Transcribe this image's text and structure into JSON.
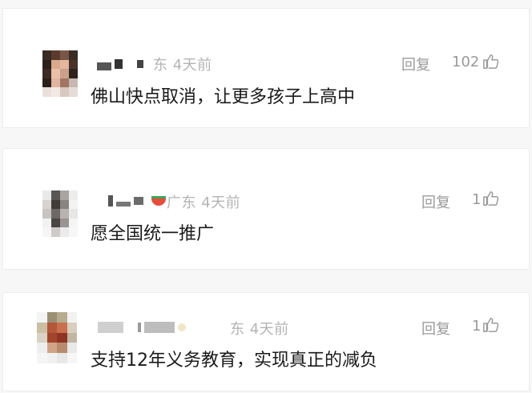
{
  "comments": [
    {
      "location_time": "东 4天前",
      "reply_label": "回复",
      "likes": "102",
      "text": "佛山快点取消，让更多孩子上高中",
      "like_icon": "thumbs-up-icon"
    },
    {
      "location_time": "广东 4天前",
      "reply_label": "回复",
      "likes": "1",
      "text": "愿全国统一推广",
      "like_icon": "thumbs-up-icon"
    },
    {
      "location_time": "东 4天前",
      "reply_label": "回复",
      "likes": "1",
      "text": "支持12年义务教育，实现真正的减负",
      "like_icon": "thumbs-up-icon"
    }
  ],
  "colors": {
    "text": "#1a1a1a",
    "meta": "#b4b4b4",
    "action": "#9a9a9a",
    "card": "#ffffff",
    "background": "#f7f7f7"
  }
}
